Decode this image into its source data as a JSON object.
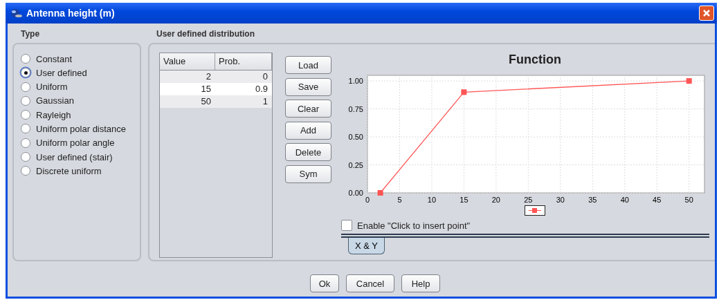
{
  "window": {
    "title": "Antenna height (m)"
  },
  "type_panel": {
    "heading": "Type",
    "options": [
      {
        "label": "Constant",
        "selected": false
      },
      {
        "label": "User defined",
        "selected": true
      },
      {
        "label": "Uniform",
        "selected": false
      },
      {
        "label": "Gaussian",
        "selected": false
      },
      {
        "label": "Rayleigh",
        "selected": false
      },
      {
        "label": "Uniform polar distance",
        "selected": false
      },
      {
        "label": "Uniform polar angle",
        "selected": false
      },
      {
        "label": "User defined (stair)",
        "selected": false
      },
      {
        "label": "Discrete uniform",
        "selected": false
      }
    ]
  },
  "distribution_panel": {
    "heading": "User defined distribution",
    "table": {
      "columns": [
        "Value",
        "Prob."
      ],
      "rows": [
        [
          "2",
          "0"
        ],
        [
          "15",
          "0.9"
        ],
        [
          "50",
          "1"
        ]
      ]
    },
    "buttons": [
      "Load",
      "Save",
      "Clear",
      "Add",
      "Delete",
      "Sym"
    ],
    "chart": {
      "chart_data": {
        "type": "line",
        "title": "Function",
        "x": [
          2,
          15,
          50
        ],
        "grid": true,
        "series": [
          {
            "color": "#ff5555",
            "marker": "square",
            "values": [
              0,
              0.9,
              1
            ]
          }
        ],
        "xlim": [
          0,
          52.4
        ],
        "ylim": [
          0,
          1.05
        ],
        "xticks": [
          0,
          5,
          10,
          15,
          20,
          25,
          30,
          35,
          40,
          45,
          50
        ],
        "yticks": [
          {
            "value": 0,
            "label": "0.00"
          },
          {
            "value": 0.25,
            "label": "0.25"
          },
          {
            "value": 0.5,
            "label": "0.50"
          },
          {
            "value": 0.75,
            "label": "0.75"
          },
          {
            "value": 1,
            "label": "1.00"
          }
        ]
      }
    },
    "insert_checkbox": {
      "label": "Enable \"Click to insert point\"",
      "checked": false
    },
    "tabs": [
      {
        "label": "X & Y",
        "selected": true
      }
    ]
  },
  "footer_buttons": [
    "Ok",
    "Cancel",
    "Help"
  ]
}
